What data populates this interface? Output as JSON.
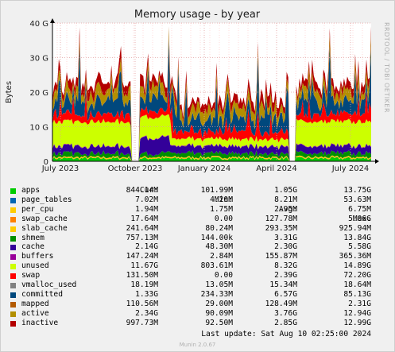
{
  "chart_data": {
    "type": "area",
    "title": "Memory usage - by year",
    "ylabel": "Bytes",
    "watermark": "RRDTOOL / TOBI OETIKER",
    "yticks": [
      "0",
      "10 G",
      "20 G",
      "30 G",
      "40 G"
    ],
    "ylim_gb": [
      0,
      40
    ],
    "xticks": [
      "July 2023",
      "October 2023",
      "January 2024",
      "April 2024",
      "July 2024"
    ],
    "grid": true,
    "stacked": true,
    "legend_headers": {
      "cur": "Cur:",
      "min": "Min:",
      "avg": "Avg:",
      "max": "Max:"
    },
    "series": [
      {
        "name": "apps",
        "color": "#00cc00",
        "cur": "844.14M",
        "min": "101.99M",
        "avg": "1.05G",
        "max": "13.75G",
        "typical_gb": 0.9
      },
      {
        "name": "page_tables",
        "color": "#0066b3",
        "cur": "7.02M",
        "min": "4.20M",
        "avg": "8.21M",
        "max": "53.63M",
        "typical_gb": 0.01
      },
      {
        "name": "per_cpu",
        "color": "#ffcc00",
        "cur": "1.94M",
        "min": "1.75M",
        "avg": "2.95M",
        "max": "6.75M",
        "typical_gb": 0.003
      },
      {
        "name": "swap_cache",
        "color": "#ff8000",
        "cur": "17.64M",
        "min": "0.00",
        "avg": "127.78M",
        "max": "5.06G",
        "typical_gb": 0.1
      },
      {
        "name": "slab_cache",
        "color": "#ffcc00",
        "cur": "241.64M",
        "min": "80.24M",
        "avg": "293.35M",
        "max": "925.94M",
        "typical_gb": 0.28
      },
      {
        "name": "shmem",
        "color": "#008f00",
        "cur": "757.13M",
        "min": "144.00k",
        "avg": "3.31G",
        "max": "13.84G",
        "typical_gb": 1.2
      },
      {
        "name": "cache",
        "color": "#330099",
        "cur": "2.14G",
        "min": "48.30M",
        "avg": "2.30G",
        "max": "5.58G",
        "typical_gb": 2.0
      },
      {
        "name": "buffers",
        "color": "#990099",
        "cur": "147.24M",
        "min": "2.84M",
        "avg": "155.87M",
        "max": "365.36M",
        "typical_gb": 0.15
      },
      {
        "name": "unused",
        "color": "#ccff00",
        "cur": "11.67G",
        "min": "803.61M",
        "avg": "8.32G",
        "max": "14.89G",
        "typical_gb": 10.0
      },
      {
        "name": "swap",
        "color": "#ff0000",
        "cur": "131.50M",
        "min": "0.00",
        "avg": "2.39G",
        "max": "72.20G",
        "typical_gb": 2.0
      },
      {
        "name": "vmalloc_used",
        "color": "#808080",
        "cur": "18.19M",
        "min": "13.05M",
        "avg": "15.34M",
        "max": "18.64M",
        "typical_gb": 0.015
      },
      {
        "name": "committed",
        "color": "#00487d",
        "cur": "1.33G",
        "min": "234.33M",
        "avg": "6.57G",
        "max": "85.13G",
        "typical_gb": 5.0
      },
      {
        "name": "mapped",
        "color": "#b35a00",
        "cur": "110.56M",
        "min": "29.00M",
        "avg": "128.49M",
        "max": "2.31G",
        "typical_gb": 0.12
      },
      {
        "name": "active",
        "color": "#b38f00",
        "cur": "2.34G",
        "min": "90.09M",
        "avg": "3.76G",
        "max": "12.94G",
        "typical_gb": 3.0
      },
      {
        "name": "inactive",
        "color": "#b30000",
        "cur": "997.73M",
        "min": "92.50M",
        "avg": "2.85G",
        "max": "12.99G",
        "typical_gb": 2.5
      }
    ]
  },
  "last_update": "Last update: Sat Aug 10 02:25:00 2024",
  "munin_version": "Munin 2.0.67"
}
